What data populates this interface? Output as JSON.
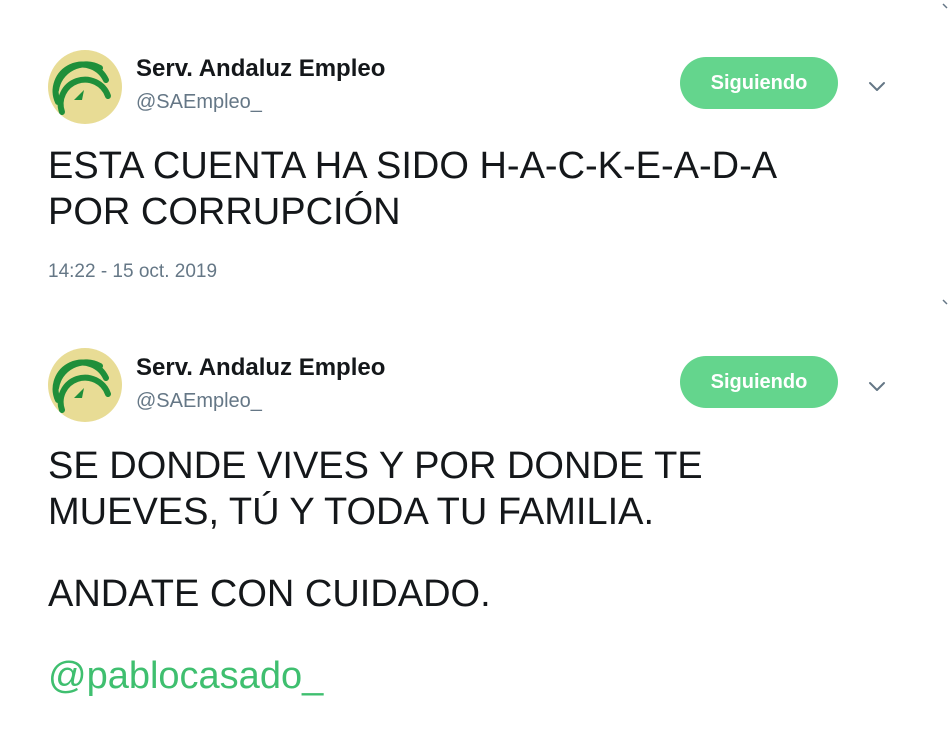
{
  "tweets": [
    {
      "author": {
        "name": "Serv. Andaluz Empleo",
        "handle": "@SAEmpleo_"
      },
      "follow_label": "Siguiendo",
      "text_lines": [
        "ESTA CUENTA HA SIDO H-A-C-K-E-A-D-A",
        "POR CORRUPCIÓN"
      ],
      "timestamp": "14:22 - 15 oct. 2019"
    },
    {
      "author": {
        "name": "Serv. Andaluz Empleo",
        "handle": "@SAEmpleo_"
      },
      "follow_label": "Siguiendo",
      "text_lines": [
        "SE DONDE VIVES Y POR DONDE TE",
        "MUEVES, TÚ Y TODA TU FAMILIA."
      ],
      "text_line_3": "ANDATE CON CUIDADO.",
      "mention": "@pablocasado_"
    }
  ],
  "colors": {
    "follow_button": "#64d58d",
    "mention": "#3fbf6f",
    "secondary_text": "#657786",
    "avatar_background": "#e8dc95",
    "logo_green": "#1f8f3a"
  },
  "icons": {
    "avatar_logo": "sae-logo-icon",
    "more_options": "chevron-down-icon"
  }
}
